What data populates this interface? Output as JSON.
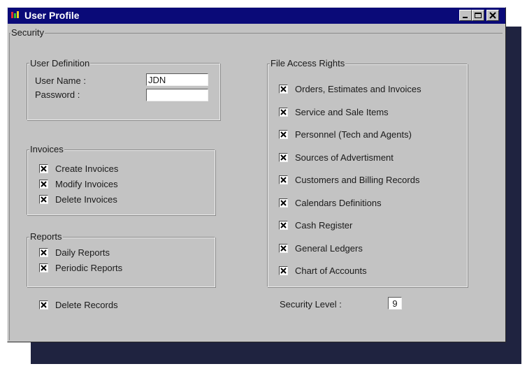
{
  "window": {
    "title": "User Profile",
    "app_icon": "app-logo-icon",
    "controls": [
      "minimize-icon",
      "maximize-icon",
      "close-icon"
    ]
  },
  "security": {
    "label": "Security",
    "user_definition": {
      "label": "User Definition",
      "user_name_label": "User Name :",
      "user_name_value": "JDN",
      "password_label": "Password :",
      "password_value": ""
    },
    "invoices": {
      "label": "Invoices",
      "items": [
        {
          "label": "Create Invoices",
          "checked": true
        },
        {
          "label": "Modify Invoices",
          "checked": true
        },
        {
          "label": "Delete Invoices",
          "checked": true
        }
      ]
    },
    "reports": {
      "label": "Reports",
      "items": [
        {
          "label": "Daily Reports",
          "checked": true
        },
        {
          "label": "Periodic Reports",
          "checked": true
        }
      ]
    },
    "delete_records": {
      "label": "Delete Records",
      "checked": true
    },
    "file_access": {
      "label": "File Access Rights",
      "items": [
        {
          "label": "Orders, Estimates and Invoices",
          "checked": true
        },
        {
          "label": "Service and Sale Items",
          "checked": true
        },
        {
          "label": "Personnel (Tech and Agents)",
          "checked": true
        },
        {
          "label": "Sources of Advertisment",
          "checked": true
        },
        {
          "label": "Customers and Billing Records",
          "checked": true
        },
        {
          "label": "Calendars Definitions",
          "checked": true
        },
        {
          "label": "Cash Register",
          "checked": true
        },
        {
          "label": "General Ledgers",
          "checked": true
        },
        {
          "label": "Chart of Accounts",
          "checked": true
        }
      ]
    },
    "security_level_label": "Security Level :",
    "security_level_value": "9"
  },
  "colors": {
    "title_bar": "#0a0a78",
    "window_face": "#c3c3c3",
    "shadow": "#1f2340"
  }
}
